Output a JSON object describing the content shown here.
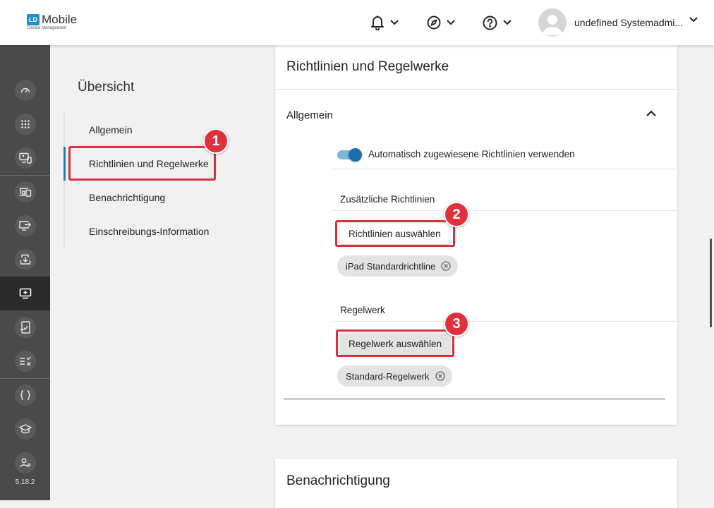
{
  "header": {
    "logo_mark": "LD",
    "logo_title": "Mobile",
    "logo_subtitle": "Device Management",
    "notifications_icon": "bell-icon",
    "explore_icon": "compass-icon",
    "help_icon": "help-circle-icon",
    "user_name": "undefined Systemadmi..."
  },
  "rail": {
    "items": [
      "dashboard-icon",
      "apps-grid-icon",
      "device-admin-icon",
      "devices-icon",
      "device-send-icon",
      "download-icon",
      "device-add-icon",
      "compliance-icon",
      "tasks-icon",
      "braces-icon",
      "education-icon",
      "user-settings-icon"
    ],
    "active_index": 6,
    "version": "5.18.2"
  },
  "overview": {
    "title": "Übersicht",
    "items": [
      "Allgemein",
      "Richtlinien und Regelwerke",
      "Benachrichtigung",
      "Einschreibungs-Information"
    ],
    "active_index": 1
  },
  "card": {
    "title": "Richtlinien und Regelwerke",
    "section_title": "Allgemein",
    "toggle_label": "Automatisch zugewiesene Richtlinien verwenden",
    "toggle_on": true,
    "policies_label": "Zusätzliche Richtlinien",
    "policies_button": "Richtlinien auswählen",
    "policies_chip": "iPad Standardrichtline",
    "ruleset_label": "Regelwerk",
    "ruleset_button": "Regelwerk auswählen",
    "ruleset_chip": "Standard-Regelwerk"
  },
  "card2": {
    "title": "Benachrichtigung"
  },
  "annotations": [
    "1",
    "2",
    "3"
  ],
  "colors": {
    "highlight": "#d9303c",
    "accent": "#1a6fb0",
    "rail": "#4a4a4a"
  }
}
